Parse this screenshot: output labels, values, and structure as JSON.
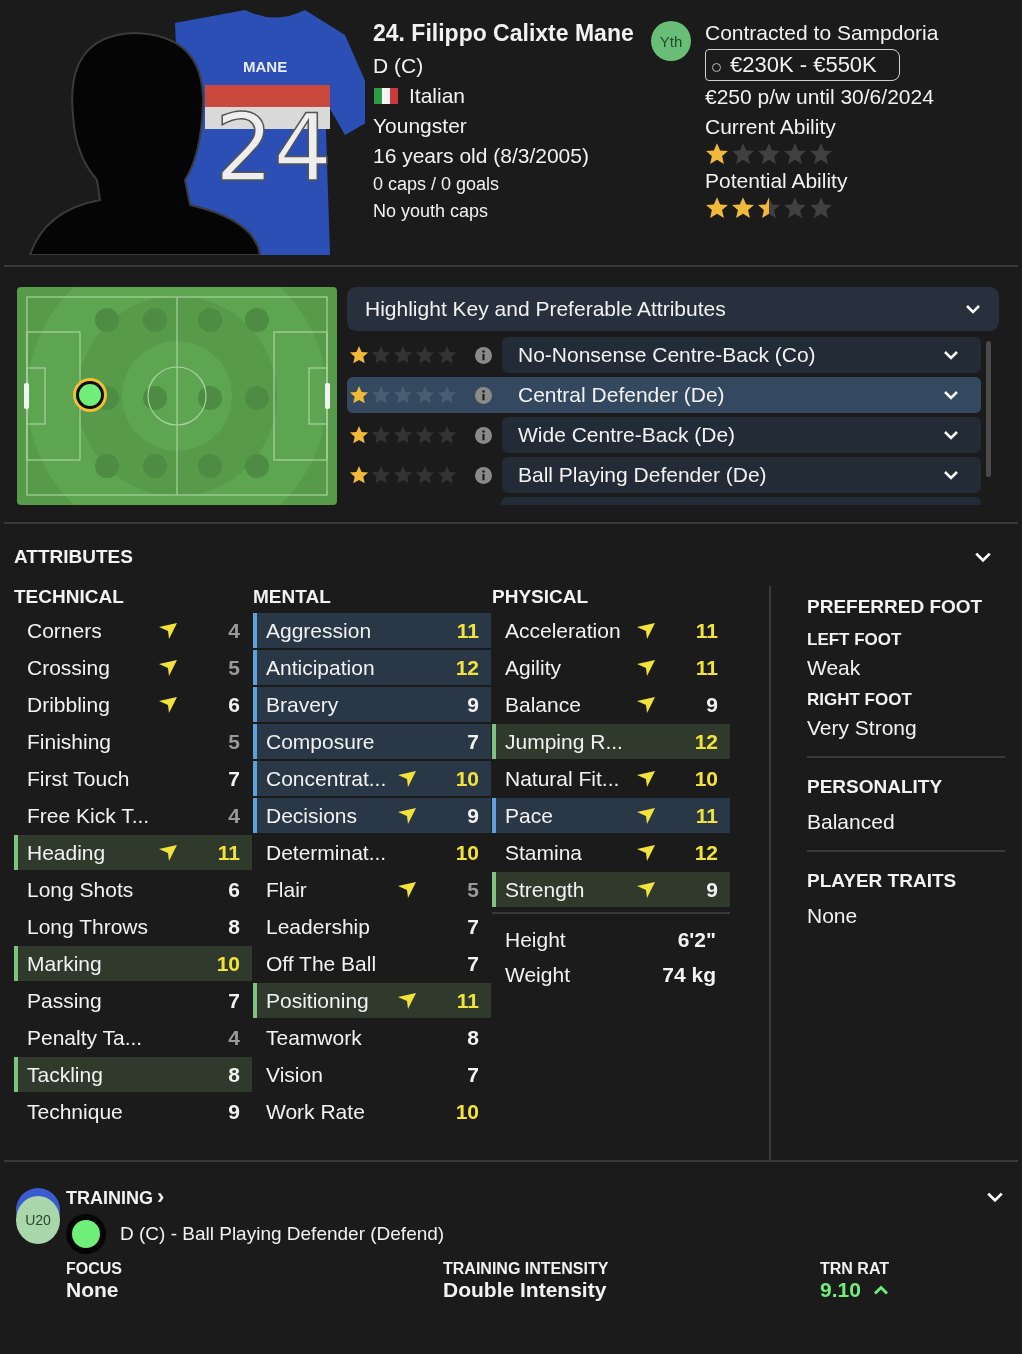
{
  "player": {
    "title": "24. Filippo Calixte Mane",
    "position": "D (C)",
    "nationality": "Italian",
    "status": "Youngster",
    "age": "16 years old (8/3/2005)",
    "caps": "0 caps / 0 goals",
    "youth_caps": "No youth caps",
    "badge": "Yth",
    "kit": {
      "name": "MANE",
      "number": "24"
    }
  },
  "contract": {
    "club": "Contracted to Sampdoria",
    "value": "€230K - €550K",
    "wage": "€250 p/w until 30/6/2024",
    "current_ability": {
      "label": "Current Ability",
      "stars": 1
    },
    "potential_ability": {
      "label": "Potential Ability",
      "stars": 2.5
    }
  },
  "roles": {
    "highlight": "Highlight Key and Preferable Attributes",
    "items": [
      {
        "name": "No-Nonsense Centre-Back (Co)",
        "stars": 1,
        "selected": false
      },
      {
        "name": "Central Defender (De)",
        "stars": 1,
        "selected": true
      },
      {
        "name": "Wide Centre-Back (De)",
        "stars": 1,
        "selected": false
      },
      {
        "name": "Ball Playing Defender (De)",
        "stars": 1,
        "selected": false
      }
    ]
  },
  "attributes": {
    "title": "ATTRIBUTES",
    "groups": [
      {
        "title": "TECHNICAL",
        "rows": [
          {
            "name": "Corners",
            "value": "4",
            "color": "#9a9a9a",
            "arrow": true,
            "key": false,
            "preferable": false
          },
          {
            "name": "Crossing",
            "value": "5",
            "color": "#9a9a9a",
            "arrow": true,
            "key": false,
            "preferable": false
          },
          {
            "name": "Dribbling",
            "value": "6",
            "color": "#f2f2f2",
            "arrow": true,
            "key": false,
            "preferable": false
          },
          {
            "name": "Finishing",
            "value": "5",
            "color": "#9a9a9a",
            "arrow": false,
            "key": false,
            "preferable": false
          },
          {
            "name": "First Touch",
            "value": "7",
            "color": "#f2f2f2",
            "arrow": false,
            "key": false,
            "preferable": false
          },
          {
            "name": "Free Kick T...",
            "value": "4",
            "color": "#9a9a9a",
            "arrow": false,
            "key": false,
            "preferable": false
          },
          {
            "name": "Heading",
            "value": "11",
            "color": "#f2e33a",
            "arrow": true,
            "key": false,
            "preferable": true
          },
          {
            "name": "Long Shots",
            "value": "6",
            "color": "#f2f2f2",
            "arrow": false,
            "key": false,
            "preferable": false
          },
          {
            "name": "Long Throws",
            "value": "8",
            "color": "#f2f2f2",
            "arrow": false,
            "key": false,
            "preferable": false
          },
          {
            "name": "Marking",
            "value": "10",
            "color": "#f2e33a",
            "arrow": false,
            "key": false,
            "preferable": true
          },
          {
            "name": "Passing",
            "value": "7",
            "color": "#f2f2f2",
            "arrow": false,
            "key": false,
            "preferable": false
          },
          {
            "name": "Penalty Ta...",
            "value": "4",
            "color": "#9a9a9a",
            "arrow": false,
            "key": false,
            "preferable": false
          },
          {
            "name": "Tackling",
            "value": "8",
            "color": "#f2f2f2",
            "arrow": false,
            "key": false,
            "preferable": true
          },
          {
            "name": "Technique",
            "value": "9",
            "color": "#f2f2f2",
            "arrow": false,
            "key": false,
            "preferable": false
          }
        ]
      },
      {
        "title": "MENTAL",
        "rows": [
          {
            "name": "Aggression",
            "value": "11",
            "color": "#f2e33a",
            "arrow": false,
            "key": true,
            "preferable": false
          },
          {
            "name": "Anticipation",
            "value": "12",
            "color": "#f2e33a",
            "arrow": false,
            "key": true,
            "preferable": false
          },
          {
            "name": "Bravery",
            "value": "9",
            "color": "#f2f2f2",
            "arrow": false,
            "key": true,
            "preferable": false
          },
          {
            "name": "Composure",
            "value": "7",
            "color": "#f2f2f2",
            "arrow": false,
            "key": true,
            "preferable": false
          },
          {
            "name": "Concentrat...",
            "value": "10",
            "color": "#f2e33a",
            "arrow": true,
            "key": true,
            "preferable": false
          },
          {
            "name": "Decisions",
            "value": "9",
            "color": "#f2f2f2",
            "arrow": true,
            "key": true,
            "preferable": false
          },
          {
            "name": "Determinat...",
            "value": "10",
            "color": "#f2e33a",
            "arrow": false,
            "key": false,
            "preferable": false
          },
          {
            "name": "Flair",
            "value": "5",
            "color": "#9a9a9a",
            "arrow": true,
            "key": false,
            "preferable": false
          },
          {
            "name": "Leadership",
            "value": "7",
            "color": "#f2f2f2",
            "arrow": false,
            "key": false,
            "preferable": false
          },
          {
            "name": "Off The Ball",
            "value": "7",
            "color": "#f2f2f2",
            "arrow": false,
            "key": false,
            "preferable": false
          },
          {
            "name": "Positioning",
            "value": "11",
            "color": "#f2e33a",
            "arrow": true,
            "key": false,
            "preferable": true
          },
          {
            "name": "Teamwork",
            "value": "8",
            "color": "#f2f2f2",
            "arrow": false,
            "key": false,
            "preferable": false
          },
          {
            "name": "Vision",
            "value": "7",
            "color": "#f2f2f2",
            "arrow": false,
            "key": false,
            "preferable": false
          },
          {
            "name": "Work Rate",
            "value": "10",
            "color": "#f2e33a",
            "arrow": false,
            "key": false,
            "preferable": false
          }
        ]
      },
      {
        "title": "PHYSICAL",
        "rows": [
          {
            "name": "Acceleration",
            "value": "11",
            "color": "#f2e33a",
            "arrow": true,
            "key": false,
            "preferable": false
          },
          {
            "name": "Agility",
            "value": "11",
            "color": "#f2e33a",
            "arrow": true,
            "key": false,
            "preferable": false
          },
          {
            "name": "Balance",
            "value": "9",
            "color": "#f2f2f2",
            "arrow": true,
            "key": false,
            "preferable": false
          },
          {
            "name": "Jumping R...",
            "value": "12",
            "color": "#f2e33a",
            "arrow": false,
            "key": false,
            "preferable": true
          },
          {
            "name": "Natural Fit...",
            "value": "10",
            "color": "#f2e33a",
            "arrow": true,
            "key": false,
            "preferable": false
          },
          {
            "name": "Pace",
            "value": "11",
            "color": "#f2e33a",
            "arrow": true,
            "key": true,
            "preferable": false
          },
          {
            "name": "Stamina",
            "value": "12",
            "color": "#f2e33a",
            "arrow": true,
            "key": false,
            "preferable": false
          },
          {
            "name": "Strength",
            "value": "9",
            "color": "#f2f2f2",
            "arrow": true,
            "key": false,
            "preferable": true
          }
        ]
      }
    ],
    "physique": [
      {
        "label": "Height",
        "value": "6'2\""
      },
      {
        "label": "Weight",
        "value": "74 kg"
      }
    ]
  },
  "side": {
    "preferred_foot": {
      "title": "PREFERRED FOOT",
      "feet": [
        {
          "label": "LEFT FOOT",
          "value": "Weak"
        },
        {
          "label": "RIGHT FOOT",
          "value": "Very Strong"
        }
      ]
    },
    "personality": {
      "title": "PERSONALITY",
      "value": "Balanced"
    },
    "traits": {
      "title": "PLAYER TRAITS",
      "value": "None"
    }
  },
  "training": {
    "title": "TRAINING",
    "chevron": "›",
    "badge": "U20",
    "role": "D (C) - Ball Playing Defender (Defend)",
    "stats": [
      {
        "label": "FOCUS",
        "value": "None",
        "kind": "plain"
      },
      {
        "label": "TRAINING INTENSITY",
        "value": "Double Intensity",
        "kind": "plain"
      },
      {
        "label": "TRN RAT",
        "value": "9.10",
        "kind": "rating"
      }
    ]
  }
}
